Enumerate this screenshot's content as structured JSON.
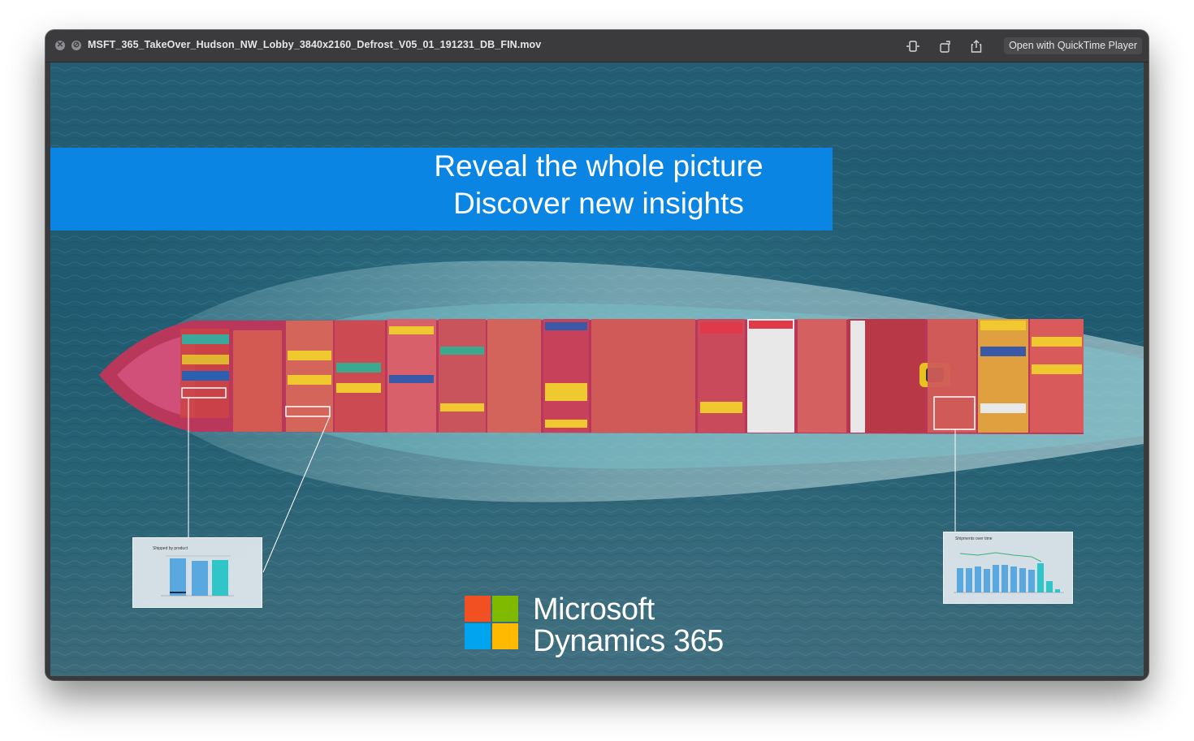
{
  "window": {
    "title": "MSFT_365_TakeOver_Hudson_NW_Lobby_3840x2160_Defrost_V05_01_191231_DB_FIN.mov",
    "open_button_label": "Open with QuickTime Player"
  },
  "icons": {
    "close": "close-icon",
    "cancel": "cancel-icon",
    "trim": "trim-icon",
    "rotate": "rotate-icon",
    "share": "share-icon"
  },
  "banner": {
    "line1": "Reveal the whole picture",
    "line2": "Discover new insights"
  },
  "left_chart": {
    "title": "Shipped by product"
  },
  "right_chart": {
    "title": "Shipments over time"
  },
  "logo": {
    "line1": "Microsoft",
    "line2": "Dynamics 365",
    "colors": [
      "#f25022",
      "#7fba00",
      "#00a4ef",
      "#ffb900"
    ]
  },
  "colors": {
    "banner": "#0b85e3",
    "titlebar": "#3b3b3d",
    "sea": "#225e73"
  }
}
